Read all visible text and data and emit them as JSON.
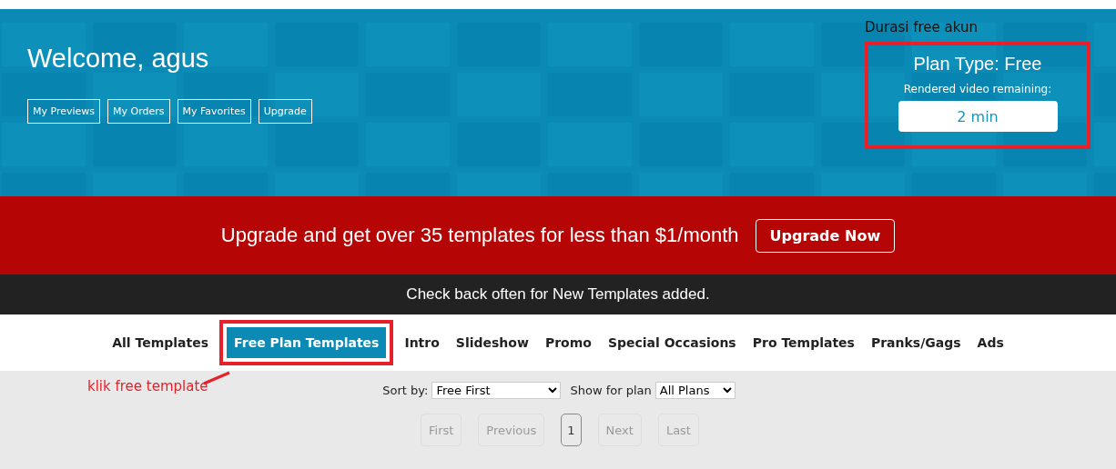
{
  "hero": {
    "title": "Welcome, agus",
    "buttons": [
      "My Previews",
      "My Orders",
      "My Favorites",
      "Upgrade"
    ],
    "plan": {
      "title": "Plan Type: Free",
      "label": "Rendered video remaining:",
      "value": "2 min"
    }
  },
  "annotations": [
    {
      "kind": "box-note",
      "text": "Durasi free akun"
    },
    {
      "kind": "pointer-note",
      "text": "klik free template"
    }
  ],
  "promo": {
    "text": "Upgrade and get over 35 templates for less than $1/month",
    "button": "Upgrade Now"
  },
  "notice": "Check back often for New Templates added.",
  "tabs": [
    {
      "label": "All Templates",
      "selected": false
    },
    {
      "label": "Free Plan Templates",
      "selected": true
    },
    {
      "label": "Intro",
      "selected": false
    },
    {
      "label": "Slideshow",
      "selected": false
    },
    {
      "label": "Promo",
      "selected": false
    },
    {
      "label": "Special Occasions",
      "selected": false
    },
    {
      "label": "Pro Templates",
      "selected": false
    },
    {
      "label": "Pranks/Gags",
      "selected": false
    },
    {
      "label": "Ads",
      "selected": false
    }
  ],
  "filters": [
    {
      "label": "Sort by:",
      "value": "Free First"
    },
    {
      "label": "Show for plan",
      "value": "All Plans"
    }
  ],
  "pagination": [
    {
      "label": "First",
      "disabled": true,
      "selected": false
    },
    {
      "label": "Previous",
      "disabled": true,
      "selected": false
    },
    {
      "label": "1",
      "disabled": false,
      "selected": true
    },
    {
      "label": "Next",
      "disabled": true,
      "selected": false
    },
    {
      "label": "Last",
      "disabled": true,
      "selected": false
    }
  ]
}
